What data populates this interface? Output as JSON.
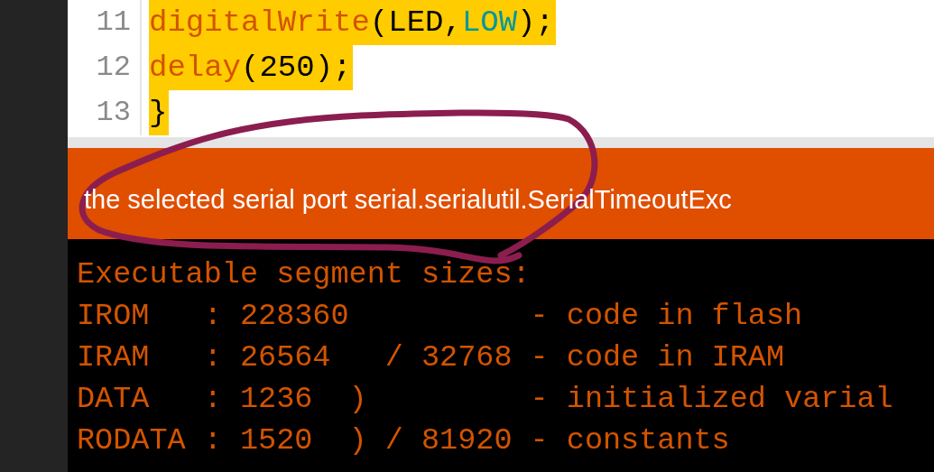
{
  "editor": {
    "lines": [
      {
        "number": "11",
        "highlighted": true,
        "tokens": [
          {
            "text": "digitalWrite",
            "kind": "function"
          },
          {
            "text": "(LED,",
            "kind": "plain"
          },
          {
            "text": "LOW",
            "kind": "constant"
          },
          {
            "text": ");",
            "kind": "plain"
          }
        ]
      },
      {
        "number": "12",
        "highlighted": true,
        "tokens": [
          {
            "text": "delay",
            "kind": "function"
          },
          {
            "text": "(250);",
            "kind": "plain"
          }
        ]
      },
      {
        "number": "13",
        "highlighted": true,
        "tokens": [
          {
            "text": "}",
            "kind": "plain"
          }
        ]
      }
    ]
  },
  "status_message": "the selected serial port serial.serialutil.SerialTimeoutExc",
  "console": {
    "lines": [
      "Executable segment sizes:",
      "IROM   : 228360          - code in flash",
      "IRAM   : 26564   / 32768 - code in IRAM",
      "DATA   : 1236  )         - initialized varial",
      "RODATA : 1520  ) / 81920 - constants"
    ]
  }
}
